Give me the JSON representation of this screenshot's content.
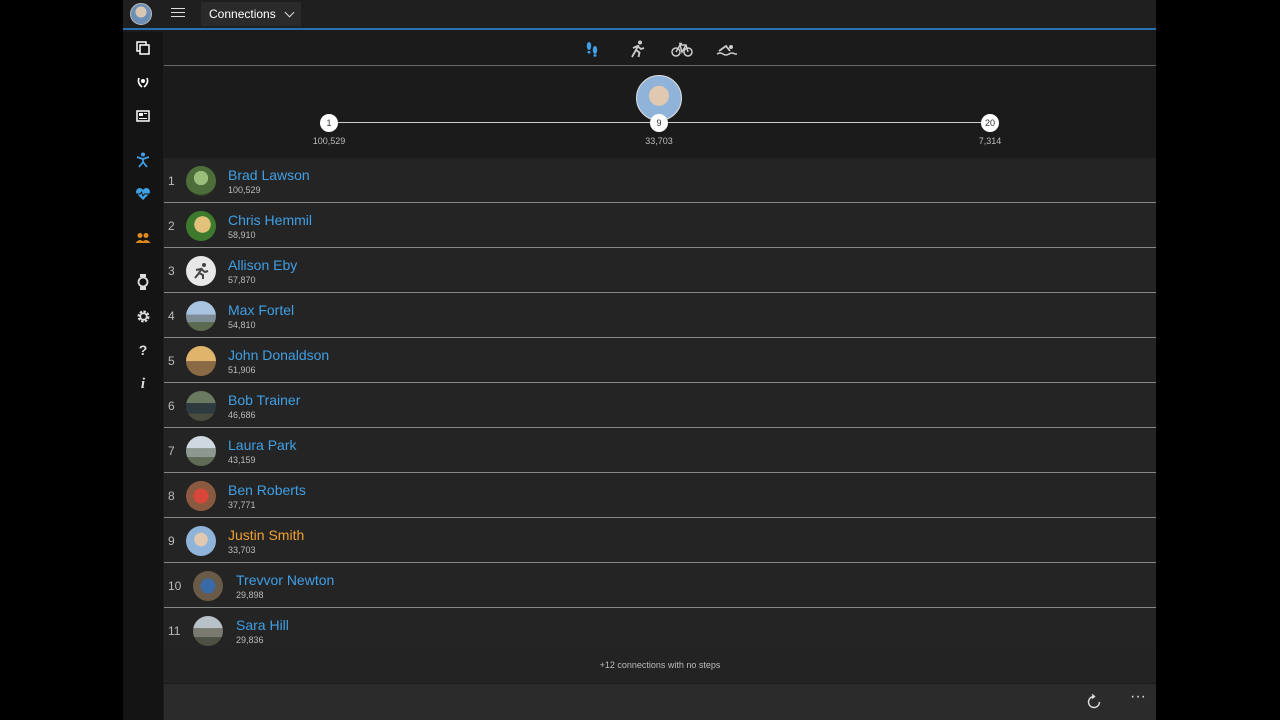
{
  "header": {
    "page_selector": "Connections"
  },
  "activity_tabs": [
    {
      "name": "steps",
      "icon": "footsteps-icon",
      "active": true
    },
    {
      "name": "running",
      "icon": "runner-icon",
      "active": false
    },
    {
      "name": "cycling",
      "icon": "bicycle-icon",
      "active": false
    },
    {
      "name": "swimming",
      "icon": "swimmer-icon",
      "active": false
    }
  ],
  "progress": {
    "markers": [
      {
        "rank": "1",
        "value": "100,529"
      },
      {
        "rank": "9",
        "value": "33,703"
      },
      {
        "rank": "20",
        "value": "7,314"
      }
    ]
  },
  "leaderboard": [
    {
      "rank": "1",
      "name": "Brad Lawson",
      "steps": "100,529"
    },
    {
      "rank": "2",
      "name": "Chris Hemmil",
      "steps": "58,910"
    },
    {
      "rank": "3",
      "name": "Allison Eby",
      "steps": "57,870"
    },
    {
      "rank": "4",
      "name": "Max Fortel",
      "steps": "54,810"
    },
    {
      "rank": "5",
      "name": "John Donaldson",
      "steps": "51,906"
    },
    {
      "rank": "6",
      "name": "Bob Trainer",
      "steps": "46,686"
    },
    {
      "rank": "7",
      "name": "Laura Park",
      "steps": "43,159"
    },
    {
      "rank": "8",
      "name": "Ben Roberts",
      "steps": "37,771"
    },
    {
      "rank": "9",
      "name": "Justin Smith",
      "steps": "33,703",
      "current_user": true
    },
    {
      "rank": "10",
      "name": "Trevvor Newton",
      "steps": "29,898"
    },
    {
      "rank": "11",
      "name": "Sara Hill",
      "steps": "29,836"
    }
  ],
  "footer": {
    "no_steps_text": "+12 connections with no steps"
  },
  "colors": {
    "accent": "#3fa0e6",
    "highlight": "#f0a030",
    "background": "#1b1b1b",
    "orange_icon": "#e08a1e"
  }
}
